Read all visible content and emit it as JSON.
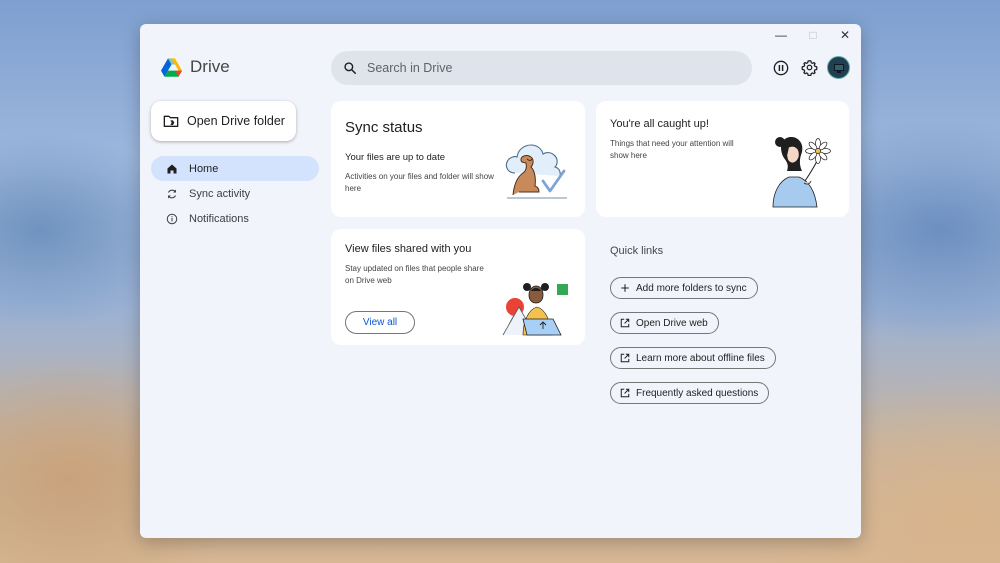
{
  "window": {
    "controls": {
      "minimize": "—",
      "maximize": "□",
      "close": "✕"
    }
  },
  "app": {
    "name": "Drive"
  },
  "search": {
    "placeholder": "Search in Drive",
    "value": ""
  },
  "toolbar": {
    "icons": [
      "pause-icon",
      "settings-icon",
      "account-avatar"
    ]
  },
  "sidebar": {
    "open_folder_label": "Open Drive folder",
    "items": [
      {
        "label": "Home",
        "icon": "home-icon",
        "active": true
      },
      {
        "label": "Sync activity",
        "icon": "sync-icon",
        "active": false
      },
      {
        "label": "Notifications",
        "icon": "info-icon",
        "active": false
      }
    ]
  },
  "cards": {
    "sync": {
      "title": "Sync status",
      "subtitle": "Your files are up to date",
      "description": "Activities on your files and folder will show here"
    },
    "caught_up": {
      "title": "You're all caught up!",
      "description": "Things that need your attention will show here"
    },
    "shared": {
      "title": "View files shared with you",
      "description": "Stay updated on files that people share on Drive web",
      "button": "View all"
    }
  },
  "quick_links": {
    "title": "Quick links",
    "items": [
      {
        "label": "Add more folders to sync",
        "icon": "plus-icon"
      },
      {
        "label": "Open Drive web",
        "icon": "open-external-icon"
      },
      {
        "label": "Learn more about offline files",
        "icon": "open-external-icon"
      },
      {
        "label": "Frequently asked questions",
        "icon": "open-external-icon"
      }
    ]
  },
  "colors": {
    "accent": "#0b57d0",
    "nav_active_bg": "#d3e3fd",
    "window_bg": "#f1f4fa"
  }
}
